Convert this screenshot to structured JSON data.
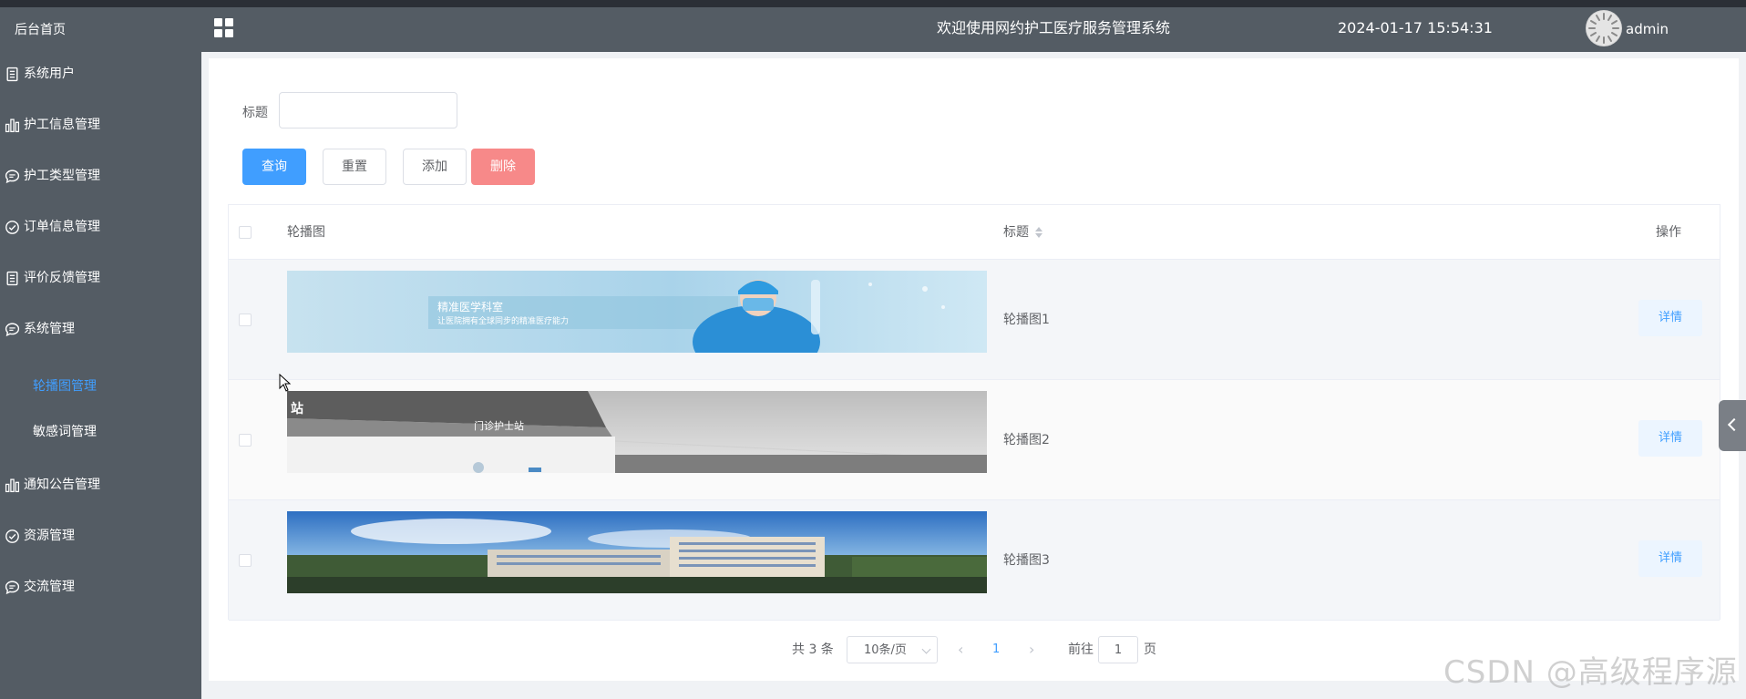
{
  "sidebar": {
    "home": "后台首页",
    "items": [
      {
        "label": "系统用户",
        "icon": "document-icon"
      },
      {
        "label": "护工信息管理",
        "icon": "bar-chart-icon"
      },
      {
        "label": "护工类型管理",
        "icon": "chat-bubble-icon"
      },
      {
        "label": "订单信息管理",
        "icon": "check-circle-icon"
      },
      {
        "label": "评价反馈管理",
        "icon": "document-icon"
      },
      {
        "label": "系统管理",
        "icon": "chat-bubble-icon"
      },
      {
        "label": "通知公告管理",
        "icon": "bar-chart-icon"
      },
      {
        "label": "资源管理",
        "icon": "check-circle-icon"
      },
      {
        "label": "交流管理",
        "icon": "chat-bubble-icon"
      }
    ],
    "submenu": [
      {
        "label": "轮播图管理",
        "active": true
      },
      {
        "label": "敏感词管理",
        "active": false
      }
    ]
  },
  "header": {
    "title": "欢迎使用网约护工医疗服务管理系统",
    "datetime": "2024-01-17 15:54:31",
    "user": "admin"
  },
  "filter": {
    "label": "标题",
    "value": "",
    "placeholder": ""
  },
  "buttons": {
    "query": "查询",
    "reset": "重置",
    "add": "添加",
    "delete": "删除"
  },
  "table": {
    "columns": {
      "image": "轮播图",
      "title": "标题",
      "action": "操作"
    },
    "rows": [
      {
        "title": "轮播图1",
        "action": "详情",
        "image_text_1": "精准医学科室",
        "image_text_2": "让医院拥有全球同步的精准医疗能力"
      },
      {
        "title": "轮播图2",
        "action": "详情",
        "image_text_1": "门诊护士站",
        "image_text_2": "站"
      },
      {
        "title": "轮播图3",
        "action": "详情"
      }
    ]
  },
  "pagination": {
    "total": "共 3 条",
    "page_size": "10条/页",
    "current_page": "1",
    "goto_label": "前往",
    "goto_value": "1",
    "page_unit": "页"
  },
  "watermark": "CSDN @高级程序源",
  "colors": {
    "sidebar_bg": "#545c64",
    "accent": "#409eff",
    "danger": "#f78989"
  }
}
